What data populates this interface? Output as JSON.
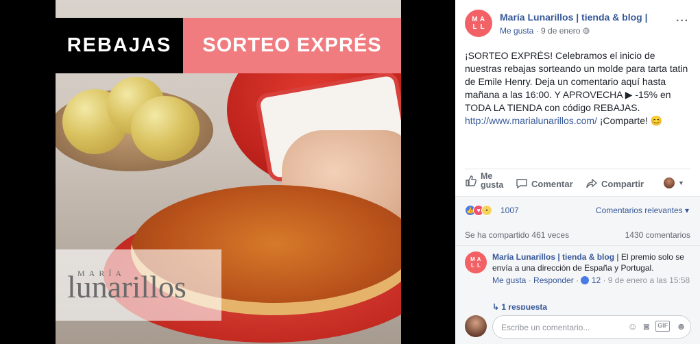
{
  "image_banner": {
    "left_text": "REBAJAS",
    "right_text": "SORTEO EXPRÉS",
    "right_color": "#f07c80"
  },
  "watermark": {
    "small": "MARÍA",
    "big": "lunarillos"
  },
  "post": {
    "page_avatar_letters": [
      "M",
      "A",
      "L",
      "L"
    ],
    "page_name": "María Lunarillos | tienda & blog |",
    "like_link": "Me gusta",
    "separator": "·",
    "date": "9 de enero",
    "privacy_icon": "globe-icon",
    "more_label": "···",
    "text_main": "¡SORTEO EXPRÉS! Celebramos el inicio de nuestras rebajas sorteando un molde para tarta tatin de Emile Henry. Deja un comentario aquí hasta mañana a las 16:00. Y APROVECHA ▶ -15% en TODA LA TIENDA con código REBAJAS. ",
    "text_url": "http://www.marialunarillos.com/",
    "text_tail": " ¡Comparte! 😊"
  },
  "actions": {
    "like_line1": "Me",
    "like_line2": "gusta",
    "comment": "Comentar",
    "share": "Compartir"
  },
  "reactions": {
    "count": "1007",
    "sort_label": "Comentarios relevantes ▾"
  },
  "stats": {
    "shared": "Se ha compartido 461 veces",
    "comments": "1430 comentarios"
  },
  "comment": {
    "avatar_letters": [
      "M",
      "A",
      "L",
      "L"
    ],
    "author": "María Lunarillos | tienda & blog",
    "text": " | El premio solo se envía a una dirección de España y Portugal.",
    "like": "Me gusta",
    "dot1": " · ",
    "reply": "Responder",
    "dot2": " · ",
    "likes": "12",
    "date": " · 9 de enero a las 15:58",
    "replies": "↳ 1 respuesta"
  },
  "composer": {
    "placeholder": "Escribe un comentario..."
  },
  "colors": {
    "link": "#365899",
    "brand_pink": "#f26166",
    "like_blue": "#4a7be5"
  }
}
